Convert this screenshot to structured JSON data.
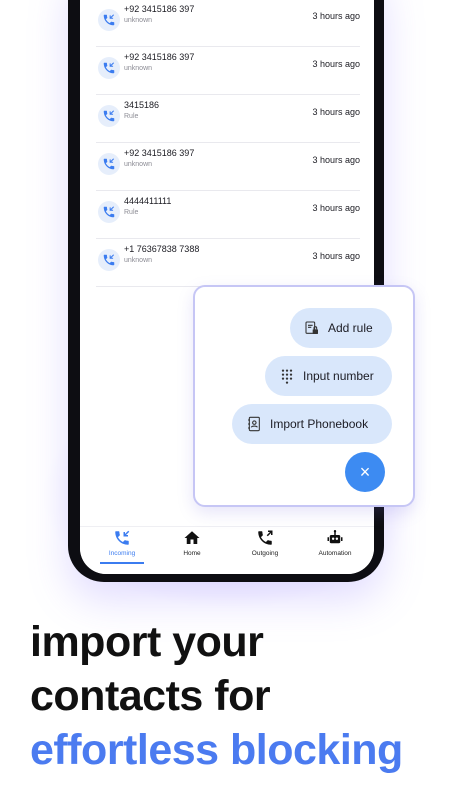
{
  "calls": [
    {
      "number": "+92 3415186 397",
      "label": "unknown",
      "time": "3 hours ago"
    },
    {
      "number": "+92 3415186 397",
      "label": "unknown",
      "time": "3 hours ago"
    },
    {
      "number": "3415186",
      "label": "Rule",
      "time": "3 hours ago"
    },
    {
      "number": "+92 3415186 397",
      "label": "unknown",
      "time": "3 hours ago"
    },
    {
      "number": "4444411111",
      "label": "Rule",
      "time": "3 hours ago"
    },
    {
      "number": "+1 76367838 7388",
      "label": "unknown",
      "time": "3 hours ago"
    }
  ],
  "menu": {
    "add_rule": "Add rule",
    "input_number": "Input number",
    "import_phonebook": "Import Phonebook",
    "close_icon": "×"
  },
  "nav": {
    "incoming": "Incoming",
    "home": "Home",
    "outgoing": "Outgoing",
    "automation": "Automation"
  },
  "headline": {
    "line1": "import your",
    "line2": "contacts for",
    "line3": "effortless blocking"
  },
  "colors": {
    "accent": "#3b7cf0",
    "headline_accent": "#4b7bf0",
    "pill_bg": "#d9e7fb",
    "fab": "#3d8bf2"
  }
}
